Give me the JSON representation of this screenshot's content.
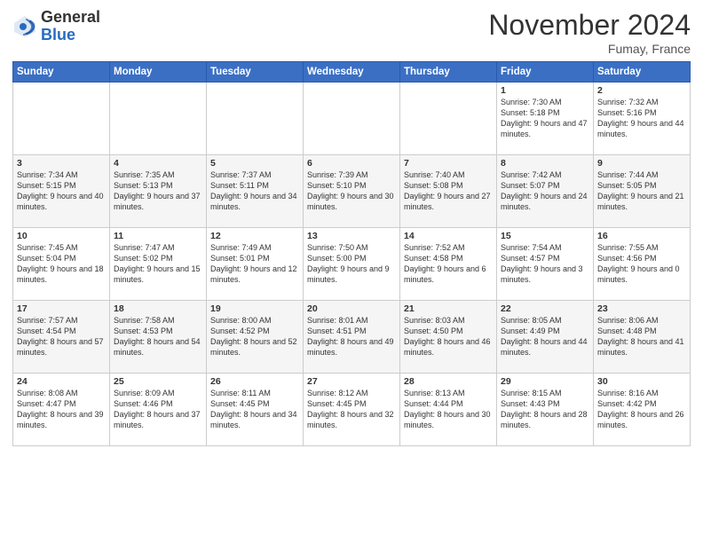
{
  "header": {
    "logo_general": "General",
    "logo_blue": "Blue",
    "month_title": "November 2024",
    "location": "Fumay, France"
  },
  "weekdays": [
    "Sunday",
    "Monday",
    "Tuesday",
    "Wednesday",
    "Thursday",
    "Friday",
    "Saturday"
  ],
  "weeks": [
    [
      {
        "day": "",
        "info": ""
      },
      {
        "day": "",
        "info": ""
      },
      {
        "day": "",
        "info": ""
      },
      {
        "day": "",
        "info": ""
      },
      {
        "day": "",
        "info": ""
      },
      {
        "day": "1",
        "info": "Sunrise: 7:30 AM\nSunset: 5:18 PM\nDaylight: 9 hours and 47 minutes."
      },
      {
        "day": "2",
        "info": "Sunrise: 7:32 AM\nSunset: 5:16 PM\nDaylight: 9 hours and 44 minutes."
      }
    ],
    [
      {
        "day": "3",
        "info": "Sunrise: 7:34 AM\nSunset: 5:15 PM\nDaylight: 9 hours and 40 minutes."
      },
      {
        "day": "4",
        "info": "Sunrise: 7:35 AM\nSunset: 5:13 PM\nDaylight: 9 hours and 37 minutes."
      },
      {
        "day": "5",
        "info": "Sunrise: 7:37 AM\nSunset: 5:11 PM\nDaylight: 9 hours and 34 minutes."
      },
      {
        "day": "6",
        "info": "Sunrise: 7:39 AM\nSunset: 5:10 PM\nDaylight: 9 hours and 30 minutes."
      },
      {
        "day": "7",
        "info": "Sunrise: 7:40 AM\nSunset: 5:08 PM\nDaylight: 9 hours and 27 minutes."
      },
      {
        "day": "8",
        "info": "Sunrise: 7:42 AM\nSunset: 5:07 PM\nDaylight: 9 hours and 24 minutes."
      },
      {
        "day": "9",
        "info": "Sunrise: 7:44 AM\nSunset: 5:05 PM\nDaylight: 9 hours and 21 minutes."
      }
    ],
    [
      {
        "day": "10",
        "info": "Sunrise: 7:45 AM\nSunset: 5:04 PM\nDaylight: 9 hours and 18 minutes."
      },
      {
        "day": "11",
        "info": "Sunrise: 7:47 AM\nSunset: 5:02 PM\nDaylight: 9 hours and 15 minutes."
      },
      {
        "day": "12",
        "info": "Sunrise: 7:49 AM\nSunset: 5:01 PM\nDaylight: 9 hours and 12 minutes."
      },
      {
        "day": "13",
        "info": "Sunrise: 7:50 AM\nSunset: 5:00 PM\nDaylight: 9 hours and 9 minutes."
      },
      {
        "day": "14",
        "info": "Sunrise: 7:52 AM\nSunset: 4:58 PM\nDaylight: 9 hours and 6 minutes."
      },
      {
        "day": "15",
        "info": "Sunrise: 7:54 AM\nSunset: 4:57 PM\nDaylight: 9 hours and 3 minutes."
      },
      {
        "day": "16",
        "info": "Sunrise: 7:55 AM\nSunset: 4:56 PM\nDaylight: 9 hours and 0 minutes."
      }
    ],
    [
      {
        "day": "17",
        "info": "Sunrise: 7:57 AM\nSunset: 4:54 PM\nDaylight: 8 hours and 57 minutes."
      },
      {
        "day": "18",
        "info": "Sunrise: 7:58 AM\nSunset: 4:53 PM\nDaylight: 8 hours and 54 minutes."
      },
      {
        "day": "19",
        "info": "Sunrise: 8:00 AM\nSunset: 4:52 PM\nDaylight: 8 hours and 52 minutes."
      },
      {
        "day": "20",
        "info": "Sunrise: 8:01 AM\nSunset: 4:51 PM\nDaylight: 8 hours and 49 minutes."
      },
      {
        "day": "21",
        "info": "Sunrise: 8:03 AM\nSunset: 4:50 PM\nDaylight: 8 hours and 46 minutes."
      },
      {
        "day": "22",
        "info": "Sunrise: 8:05 AM\nSunset: 4:49 PM\nDaylight: 8 hours and 44 minutes."
      },
      {
        "day": "23",
        "info": "Sunrise: 8:06 AM\nSunset: 4:48 PM\nDaylight: 8 hours and 41 minutes."
      }
    ],
    [
      {
        "day": "24",
        "info": "Sunrise: 8:08 AM\nSunset: 4:47 PM\nDaylight: 8 hours and 39 minutes."
      },
      {
        "day": "25",
        "info": "Sunrise: 8:09 AM\nSunset: 4:46 PM\nDaylight: 8 hours and 37 minutes."
      },
      {
        "day": "26",
        "info": "Sunrise: 8:11 AM\nSunset: 4:45 PM\nDaylight: 8 hours and 34 minutes."
      },
      {
        "day": "27",
        "info": "Sunrise: 8:12 AM\nSunset: 4:45 PM\nDaylight: 8 hours and 32 minutes."
      },
      {
        "day": "28",
        "info": "Sunrise: 8:13 AM\nSunset: 4:44 PM\nDaylight: 8 hours and 30 minutes."
      },
      {
        "day": "29",
        "info": "Sunrise: 8:15 AM\nSunset: 4:43 PM\nDaylight: 8 hours and 28 minutes."
      },
      {
        "day": "30",
        "info": "Sunrise: 8:16 AM\nSunset: 4:42 PM\nDaylight: 8 hours and 26 minutes."
      }
    ]
  ]
}
